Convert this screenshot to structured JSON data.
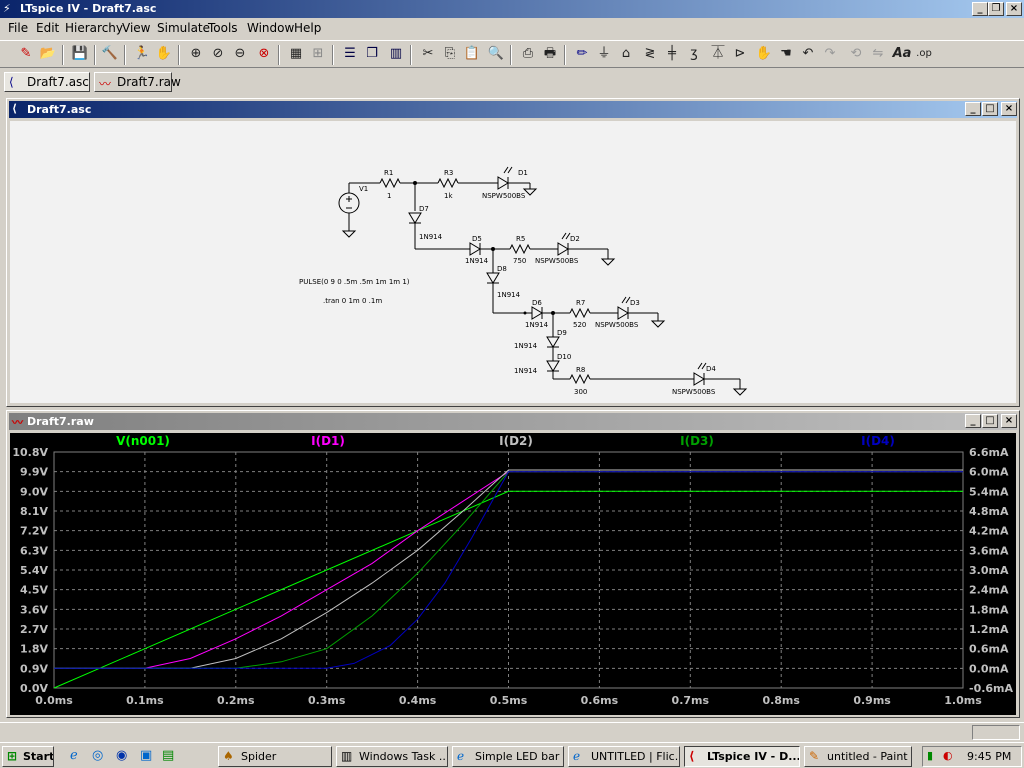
{
  "window": {
    "title": "LTspice IV - Draft7.asc"
  },
  "menu": [
    "File",
    "Edit",
    "Hierarchy",
    "View",
    "Simulate",
    "Tools",
    "Window",
    "Help"
  ],
  "tabs": [
    {
      "label": "Draft7.asc",
      "icon": "schematic-icon",
      "active": true
    },
    {
      "label": "Draft7.raw",
      "icon": "waveform-icon",
      "active": false
    }
  ],
  "schematic": {
    "title": "Draft7.asc",
    "labels": {
      "v1": "V1",
      "r1": "R1",
      "r1v": "1",
      "r3": "R3",
      "r3v": "1k",
      "d1": "D1",
      "d1m": "NSPW500BS",
      "d7": "D7",
      "d7m": "1N914",
      "d5": "D5",
      "d5m": "1N914",
      "r5": "R5",
      "r5v": "750",
      "d2": "D2",
      "d2m": "NSPW500BS",
      "d8": "D8",
      "d8m": "1N914",
      "d6": "D6",
      "d6m": "1N914",
      "r7": "R7",
      "r7v": "520",
      "d3": "D3",
      "d3m": "NSPW500BS",
      "d9": "D9",
      "d9m": "1N914",
      "d10": "D10",
      "d10m": "1N914",
      "r8": "R8",
      "r8v": "300",
      "d4": "D4",
      "d4m": "NSPW500BS",
      "pulse": "PULSE(0 9 0 .5m .5m 1m 1m 1)",
      "tran": ".tran 0 1m 0 .1m"
    }
  },
  "waveform": {
    "title": "Draft7.raw",
    "colors": {
      "bg": "#000000",
      "grid": "#808080",
      "v": "#00ff00",
      "d1": "#ff00ff",
      "d2": "#c0c0c0",
      "d3": "#00a000",
      "d4": "#0000c0"
    }
  },
  "chart_data": {
    "type": "line",
    "x_label_unit": "ms",
    "xlim": [
      0,
      1.0
    ],
    "x_ticks": [
      "0.0ms",
      "0.1ms",
      "0.2ms",
      "0.3ms",
      "0.4ms",
      "0.5ms",
      "0.6ms",
      "0.7ms",
      "0.8ms",
      "0.9ms",
      "1.0ms"
    ],
    "y_left_ticks": [
      "10.8V",
      "9.9V",
      "9.0V",
      "8.1V",
      "7.2V",
      "6.3V",
      "5.4V",
      "4.5V",
      "3.6V",
      "2.7V",
      "1.8V",
      "0.9V",
      "0.0V"
    ],
    "y_right_ticks": [
      "6.6mA",
      "6.0mA",
      "5.4mA",
      "4.8mA",
      "4.2mA",
      "3.6mA",
      "3.0mA",
      "2.4mA",
      "1.8mA",
      "1.2mA",
      "0.6mA",
      "0.0mA",
      "-0.6mA"
    ],
    "ylim_left": [
      0,
      10.8
    ],
    "ylim_right": [
      -0.6,
      6.6
    ],
    "series": [
      {
        "name": "V(n001)",
        "axis": "left",
        "x": [
          0,
          0.1,
          0.2,
          0.3,
          0.4,
          0.5,
          1.0
        ],
        "y": [
          0,
          1.8,
          3.6,
          5.4,
          7.2,
          9.0,
          9.0
        ]
      },
      {
        "name": "I(D1)",
        "axis": "right",
        "x": [
          0,
          0.1,
          0.15,
          0.2,
          0.25,
          0.3,
          0.35,
          0.4,
          0.45,
          0.5,
          1.0
        ],
        "y": [
          0,
          0,
          0.3,
          0.9,
          1.6,
          2.4,
          3.2,
          4.2,
          5.1,
          6.0,
          6.0
        ]
      },
      {
        "name": "I(D2)",
        "axis": "right",
        "x": [
          0,
          0.15,
          0.2,
          0.25,
          0.3,
          0.35,
          0.4,
          0.45,
          0.5,
          1.0
        ],
        "y": [
          0,
          0,
          0.3,
          0.9,
          1.7,
          2.6,
          3.6,
          4.8,
          6.05,
          6.05
        ]
      },
      {
        "name": "I(D3)",
        "axis": "right",
        "x": [
          0,
          0.2,
          0.25,
          0.3,
          0.35,
          0.4,
          0.45,
          0.5,
          1.0
        ],
        "y": [
          0,
          0,
          0.2,
          0.6,
          1.6,
          2.9,
          4.4,
          6.0,
          6.0
        ]
      },
      {
        "name": "I(D4)",
        "axis": "right",
        "x": [
          0,
          0.3,
          0.33,
          0.37,
          0.4,
          0.43,
          0.46,
          0.5,
          1.0
        ],
        "y": [
          0,
          0,
          0.15,
          0.7,
          1.5,
          2.6,
          4.0,
          6.0,
          6.0
        ]
      }
    ]
  },
  "taskbar": {
    "start": "Start",
    "items": [
      "Spider",
      "Windows Task ...",
      "Simple LED bar ...",
      "UNTITLED | Flic...",
      "LTspice IV - D...",
      "untitled - Paint"
    ],
    "clock": "9:45 PM"
  }
}
